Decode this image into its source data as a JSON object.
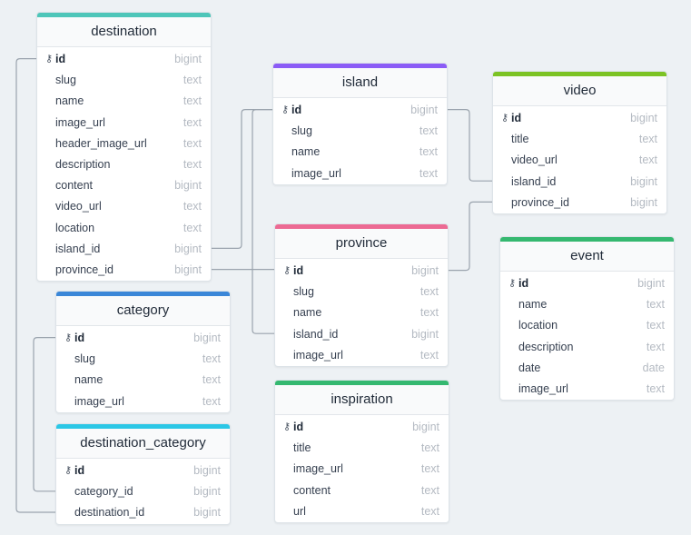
{
  "tables": {
    "destination": {
      "title": "destination",
      "color": "#4ec6b9",
      "columns": [
        {
          "name": "id",
          "type": "bigint"
        },
        {
          "name": "slug",
          "type": "text"
        },
        {
          "name": "name",
          "type": "text"
        },
        {
          "name": "image_url",
          "type": "text"
        },
        {
          "name": "header_image_url",
          "type": "text"
        },
        {
          "name": "description",
          "type": "text"
        },
        {
          "name": "content",
          "type": "bigint"
        },
        {
          "name": "video_url",
          "type": "text"
        },
        {
          "name": "location",
          "type": "text"
        },
        {
          "name": "island_id",
          "type": "bigint"
        },
        {
          "name": "province_id",
          "type": "bigint"
        }
      ]
    },
    "island": {
      "title": "island",
      "color": "#8b5cf6",
      "columns": [
        {
          "name": "id",
          "type": "bigint"
        },
        {
          "name": "slug",
          "type": "text"
        },
        {
          "name": "name",
          "type": "text"
        },
        {
          "name": "image_url",
          "type": "text"
        }
      ]
    },
    "video": {
      "title": "video",
      "color": "#7cc324",
      "columns": [
        {
          "name": "id",
          "type": "bigint"
        },
        {
          "name": "title",
          "type": "text"
        },
        {
          "name": "video_url",
          "type": "text"
        },
        {
          "name": "island_id",
          "type": "bigint"
        },
        {
          "name": "province_id",
          "type": "bigint"
        }
      ]
    },
    "province": {
      "title": "province",
      "color": "#ec6a93",
      "columns": [
        {
          "name": "id",
          "type": "bigint"
        },
        {
          "name": "slug",
          "type": "text"
        },
        {
          "name": "name",
          "type": "text"
        },
        {
          "name": "island_id",
          "type": "bigint"
        },
        {
          "name": "image_url",
          "type": "text"
        }
      ]
    },
    "event": {
      "title": "event",
      "color": "#35b870",
      "columns": [
        {
          "name": "id",
          "type": "bigint"
        },
        {
          "name": "name",
          "type": "text"
        },
        {
          "name": "location",
          "type": "text"
        },
        {
          "name": "description",
          "type": "text"
        },
        {
          "name": "date",
          "type": "date"
        },
        {
          "name": "image_url",
          "type": "text"
        }
      ]
    },
    "category": {
      "title": "category",
      "color": "#3b87d8",
      "columns": [
        {
          "name": "id",
          "type": "bigint"
        },
        {
          "name": "slug",
          "type": "text"
        },
        {
          "name": "name",
          "type": "text"
        },
        {
          "name": "image_url",
          "type": "text"
        }
      ]
    },
    "destination_category": {
      "title": "destination_category",
      "color": "#2bc7e6",
      "columns": [
        {
          "name": "id",
          "type": "bigint"
        },
        {
          "name": "category_id",
          "type": "bigint"
        },
        {
          "name": "destination_id",
          "type": "bigint"
        }
      ]
    },
    "inspiration": {
      "title": "inspiration",
      "color": "#35b870",
      "columns": [
        {
          "name": "id",
          "type": "bigint"
        },
        {
          "name": "title",
          "type": "text"
        },
        {
          "name": "image_url",
          "type": "text"
        },
        {
          "name": "content",
          "type": "text"
        },
        {
          "name": "url",
          "type": "text"
        }
      ]
    }
  },
  "relationships": [
    {
      "from": "destination.island_id",
      "to": "island.id"
    },
    {
      "from": "destination.province_id",
      "to": "province.id"
    },
    {
      "from": "province.island_id",
      "to": "island.id"
    },
    {
      "from": "video.island_id",
      "to": "island.id"
    },
    {
      "from": "video.province_id",
      "to": "province.id"
    },
    {
      "from": "destination_category.category_id",
      "to": "category.id"
    },
    {
      "from": "destination_category.destination_id",
      "to": "destination.id"
    }
  ]
}
